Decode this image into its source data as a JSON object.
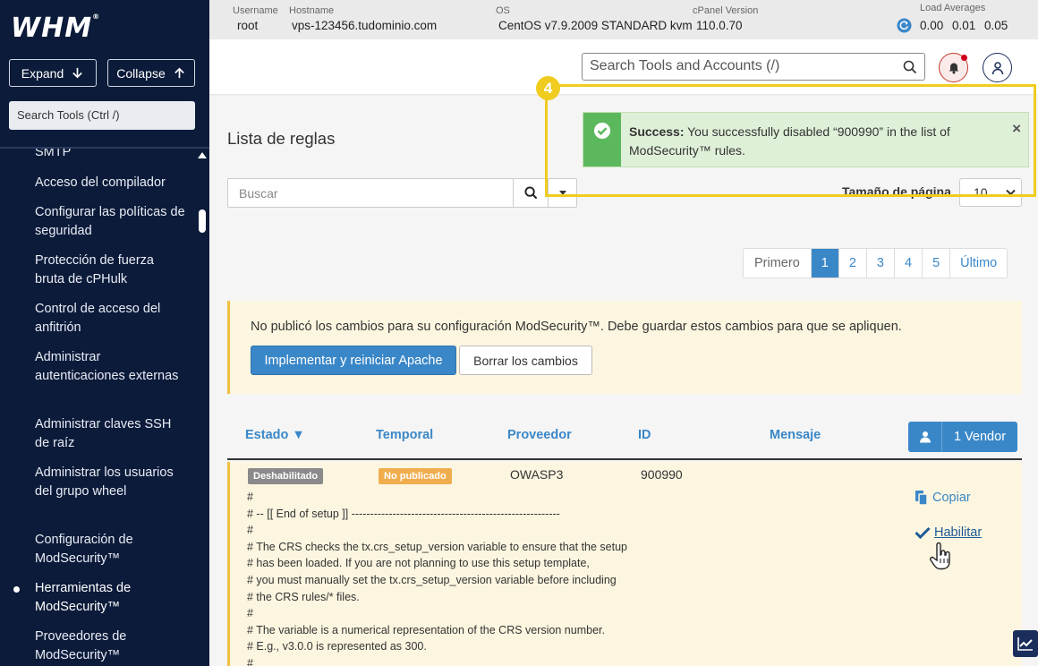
{
  "sidebar": {
    "logo": "WHM",
    "expand_label": "Expand",
    "collapse_label": "Collapse",
    "search_placeholder": "Search Tools (Ctrl /)",
    "items": [
      {
        "label": "SMTP"
      },
      {
        "label": "Acceso del compilador"
      },
      {
        "label": "Configurar las políticas de seguridad"
      },
      {
        "label": "Protección de fuerza bruta de cPHulk"
      },
      {
        "label": "Control de acceso del anfitrión"
      },
      {
        "label": "Administrar autenticaciones externas"
      },
      {
        "label": "Administrar claves SSH de raíz"
      },
      {
        "label": "Administrar los usuarios del grupo wheel"
      },
      {
        "label": "Configuración de ModSecurity™"
      },
      {
        "label": "Herramientas de ModSecurity™",
        "active": true
      },
      {
        "label": "Proveedores de ModSecurity™"
      }
    ]
  },
  "header": {
    "username_label": "Username",
    "username": "root",
    "hostname_label": "Hostname",
    "hostname": "vps-123456.tudominio.com",
    "os_label": "OS",
    "os": "CentOS v7.9.2009 STANDARD kvm",
    "cpanel_label": "cPanel Version",
    "cpanel": "110.0.70",
    "load_label": "Load Averages",
    "load1": "0.00",
    "load5": "0.01",
    "load15": "0.05"
  },
  "toolbar": {
    "search_placeholder": "Search Tools and Accounts (/)"
  },
  "main": {
    "title": "Lista de reglas",
    "search_placeholder": "Buscar",
    "page_size_label": "Tamaño de página",
    "page_size": "10",
    "pagination": [
      "Primero",
      "1",
      "2",
      "3",
      "4",
      "5",
      "Último"
    ],
    "current_page": "1",
    "warning": {
      "text": "No publicó los cambios para su configuración ModSecurity™. Debe guardar estos cambios para que se apliquen.",
      "deploy_label": "Implementar y reiniciar Apache",
      "discard_label": "Borrar los cambios"
    },
    "table": {
      "headers": [
        "Estado ▼",
        "Temporal",
        "Proveedor",
        "ID",
        "Mensaje"
      ],
      "vendor_button": "1 Vendor",
      "row": {
        "status": "Deshabilitado",
        "temporal": "No publicado",
        "vendor": "OWASP3",
        "id": "900990",
        "code": "#\n# -- [[ End of setup ]] --------------------------------------------------------\n#\n# The CRS checks the tx.crs_setup_version variable to ensure that the setup\n# has been loaded. If you are not planning to use this setup template,\n# you must manually set the tx.crs_setup_version variable before including\n# the CRS rules/* files.\n#\n# The variable is a numerical representation of the CRS version number.\n# E.g., v3.0.0 is represented as 300.\n#",
        "copy_label": "Copiar",
        "enable_label": "Habilitar"
      }
    }
  },
  "alert": {
    "strong": "Success:",
    "text": " You successfully disabled “900990” in the list of ModSecurity™ rules.",
    "close": "×",
    "step_number": "4"
  },
  "colors": {
    "sidebar_bg": "#0c1b3a",
    "primary": "#3a87c8",
    "success": "#5cb85c",
    "highlight": "#f0cc1e",
    "warning_bg": "#fcf6e0"
  }
}
